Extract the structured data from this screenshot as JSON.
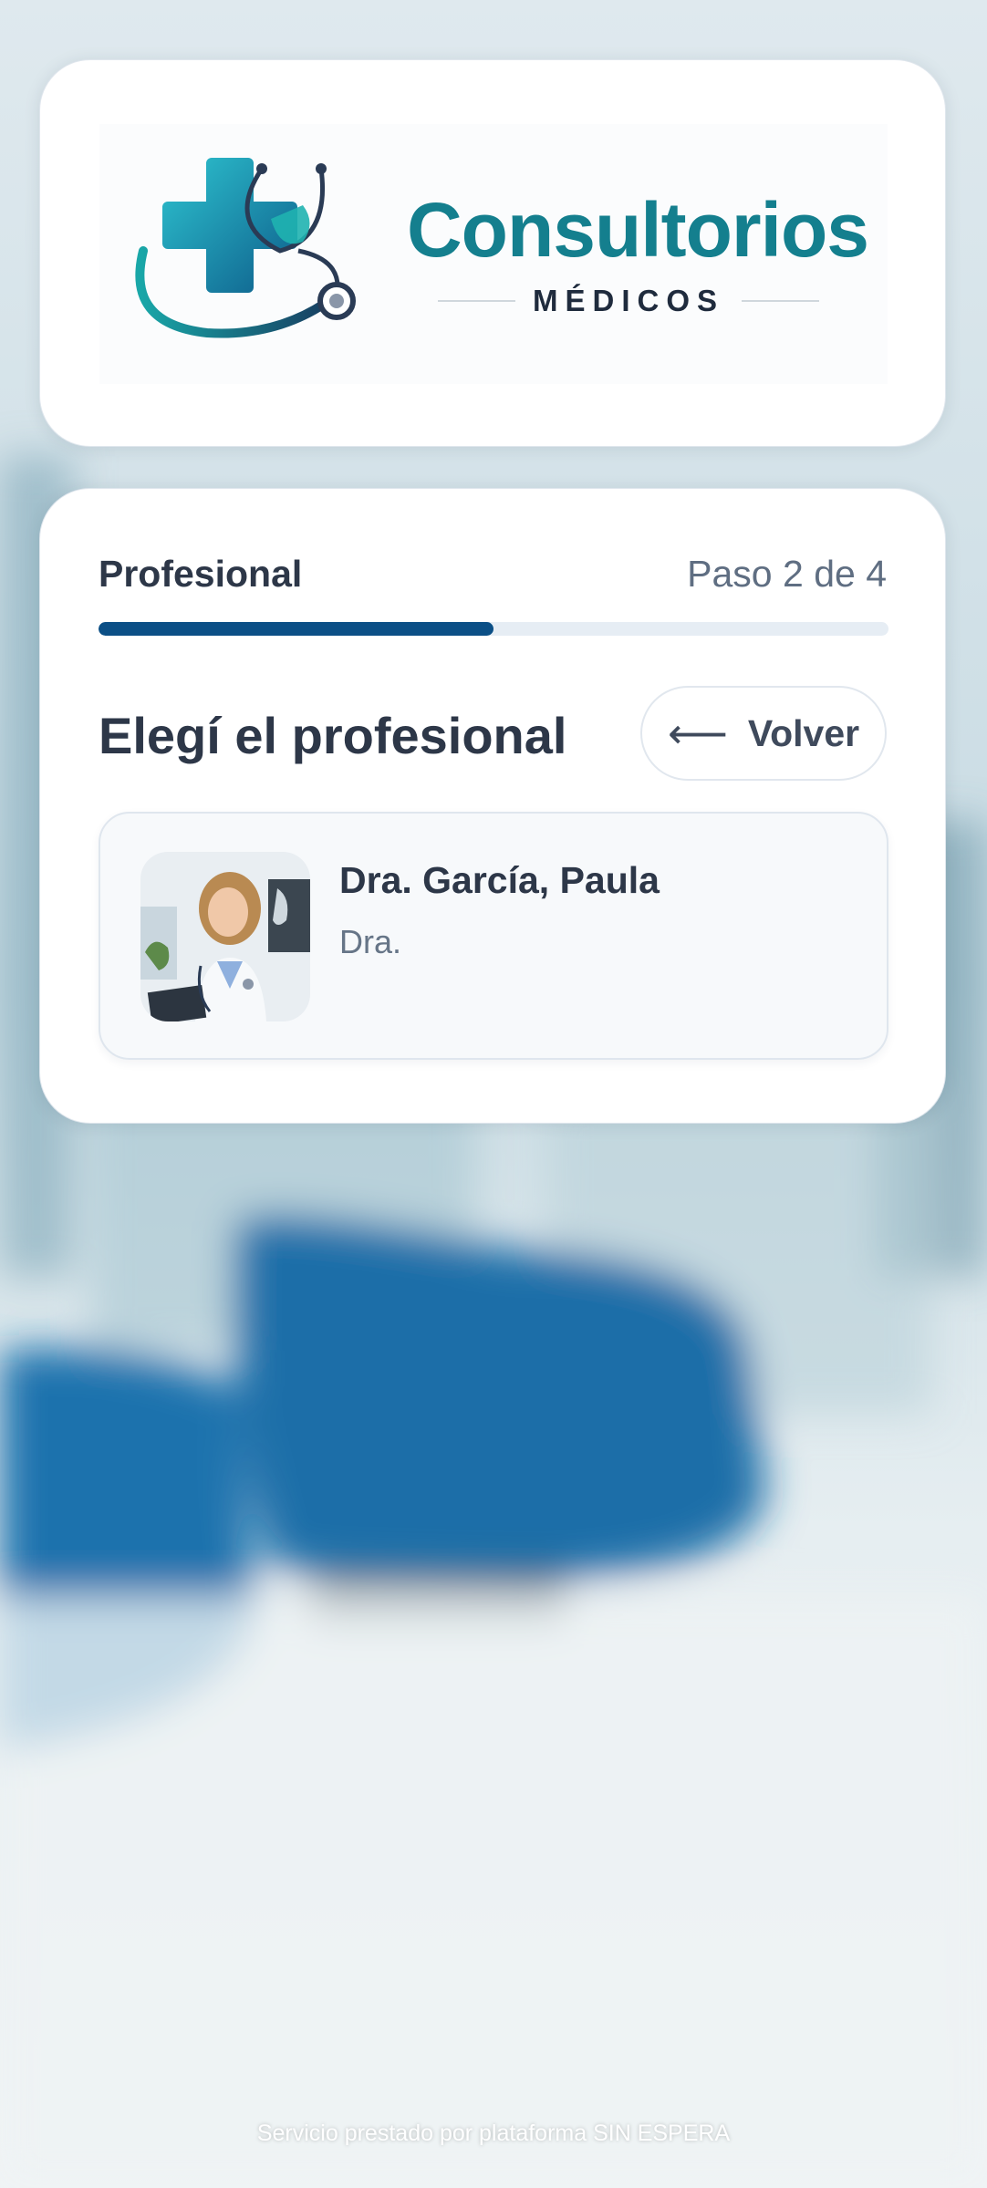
{
  "brand": {
    "title": "Consultorios",
    "subtitle": "MÉDICOS",
    "colors": {
      "teal": "#147f8e",
      "navy": "#1f2b3d",
      "cross": "#17a2b8"
    }
  },
  "wizard": {
    "step_label": "Profesional",
    "step_count": "Paso 2 de 4",
    "progress_fraction": 0.5,
    "heading": "Elegí el profesional",
    "back_icon": "arrow-left-icon",
    "back_label": "Volver"
  },
  "professionals": [
    {
      "name": "Dra. García, Paula",
      "title": "Dra."
    }
  ],
  "footer": {
    "text": "Servicio prestado por plataforma SIN ESPERA"
  },
  "colors": {
    "accent": "#0b4f86",
    "track": "#e6edf4",
    "text": "#2d3748",
    "muted": "#5f6e82"
  }
}
